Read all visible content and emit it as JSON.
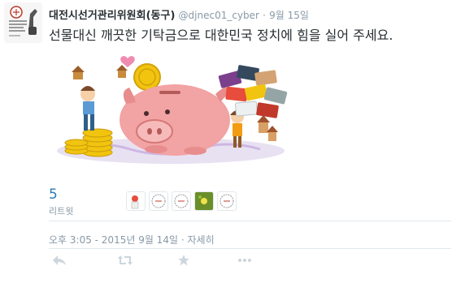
{
  "tweet": {
    "author_name": "대전시선거관리위원회(동구)",
    "handle": "@djnec01_cyber",
    "separator": "·",
    "short_time": "9월 15일",
    "text": "선물대신 깨끗한 기탁금으로 대한민국 정치에 힘을 실어 주세요.",
    "retweet_count": "5",
    "retweet_label": "리트윗",
    "timestamp": "오후 3:05 - 2015년 9월 14일",
    "details_sep": "·",
    "details_link": "자세히"
  },
  "icons": {
    "reply": "reply-icon",
    "retweet": "retweet-icon",
    "favorite": "star-icon",
    "more": "more-icon"
  },
  "colors": {
    "link": "#2b7bb9",
    "muted": "#8899a6",
    "text": "#292f33",
    "divider": "#e1e8ed",
    "icon": "#ccd6dd"
  }
}
